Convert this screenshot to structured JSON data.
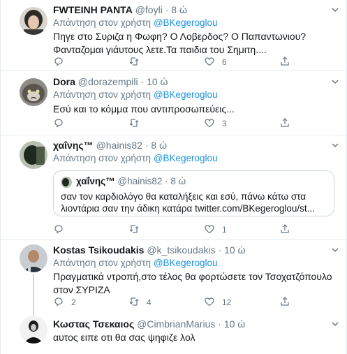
{
  "tweets": [
    {
      "name": "FWTEINH PANTA",
      "handle": "@foyli",
      "dot": "·",
      "time": "8 ώ",
      "reply_prefix": "Απάντηση στον χρήστη",
      "reply_mention": "@BKegeroglou",
      "text": "Πηγε στο Συριζα η Φωφη? Ο Λοβερδος? Ο Παπαντωνιου? Φανταζομαι γιάυτους λετε.Τα παιδια του Σημιτη....",
      "replies": "",
      "retweets": "",
      "likes": "6"
    },
    {
      "name": "Dora",
      "handle": "@dorazempili",
      "dot": "·",
      "time": "10 ώ",
      "reply_prefix": "Απάντηση στον χρήστη",
      "reply_mention": "@BKegeroglou",
      "text": "Εσύ και το κόμμα που αντιπροσωπεύεις...",
      "replies": "",
      "retweets": "",
      "likes": "3"
    },
    {
      "name": "χαΐνης™",
      "handle": "@hainis82",
      "dot": "·",
      "time": "8 ώ",
      "reply_prefix": "Απάντηση στον χρήστη",
      "reply_mention": "@BKegeroglou",
      "quote": {
        "name": "χαΐνης™",
        "handle": "@hainis82",
        "dot": "·",
        "time": "8 ώ",
        "text": "σαν τον καρδιολόγο θα καταλήξεις και εσύ, πάνω κάτω στα λιοντάρια σαν την άδικη κατάρα twitter.com/BKegeroglou/st..."
      },
      "replies": "",
      "retweets": "",
      "likes": "1"
    },
    {
      "name": "Kostas Tsikoudakis",
      "handle": "@k_tsikoudakis",
      "dot": "·",
      "time": "10 ώ",
      "reply_prefix": "Απάντηση στον χρήστη",
      "reply_mention": "@BKegeroglou",
      "text": "Πραγματικά ντροπή,στο τέλος θα φορτώσετε τον Τσοχατζόπουλο στον ΣΥΡΙΖΑ",
      "replies": "2",
      "retweets": "4",
      "likes": "12"
    },
    {
      "name": "Κωστας Τσεκαιος",
      "handle": "@CimbrianMarius",
      "dot": "·",
      "time": "10 ώ",
      "text": "αυτος ειπε οτι θα σας ψηφιζε λολ"
    }
  ],
  "icons": {
    "reply": "reply-icon",
    "retweet": "retweet-icon",
    "like": "heart-icon",
    "share": "share-icon",
    "more": "chevron-down-icon"
  },
  "colors": {
    "mention": "#1b95e0",
    "secondary_text": "#657786",
    "border": "#e6ecf0"
  }
}
